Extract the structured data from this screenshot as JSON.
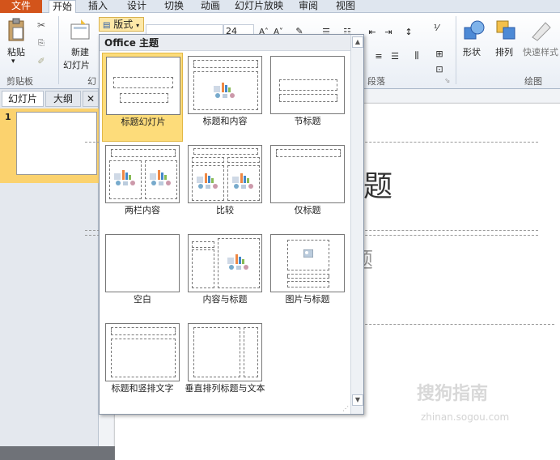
{
  "tabs": [
    "文件",
    "开始",
    "插入",
    "设计",
    "切换",
    "动画",
    "幻灯片放映",
    "审阅",
    "视图"
  ],
  "ribbon": {
    "paste_label": "粘贴",
    "new_slide_label": [
      "新建",
      "幻灯片"
    ],
    "layout_label": "版式",
    "font_size": "24",
    "shape_label": "形状",
    "arrange_label": "排列",
    "quick_styles_label": "快速样式",
    "groups": {
      "clipboard": "剪贴板",
      "slides_short": "幻",
      "paragraph": "段落",
      "drawing": "绘图"
    }
  },
  "panel": {
    "tab_slides": "幻灯片",
    "tab_outline": "大纲",
    "slide_number": "1"
  },
  "dropdown": {
    "header": "Office 主题",
    "layouts": [
      {
        "name": "标题幻灯片",
        "selected": true
      },
      {
        "name": "标题和内容"
      },
      {
        "name": "节标题"
      },
      {
        "name": "两栏内容"
      },
      {
        "name": "比较"
      },
      {
        "name": "仅标题"
      },
      {
        "name": "空白"
      },
      {
        "name": "内容与标题"
      },
      {
        "name": "图片与标题"
      },
      {
        "name": "标题和竖排文字"
      },
      {
        "name": "垂直排列标题与文本"
      }
    ]
  },
  "slide": {
    "title_placeholder": "处添加标题",
    "subtitle_placeholder": "处添加副标题"
  },
  "watermark": {
    "brand": "搜狗指南",
    "url": "zhinan.sogou.com"
  }
}
